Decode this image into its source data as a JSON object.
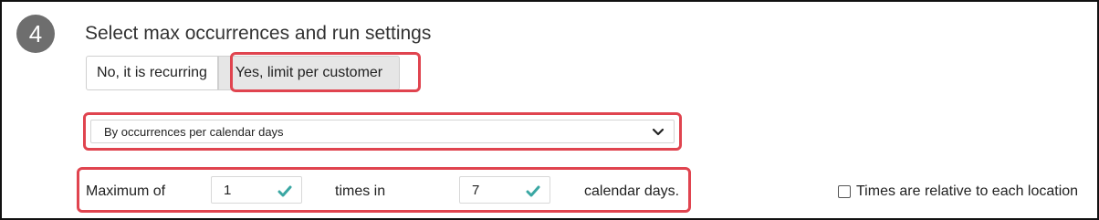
{
  "step": {
    "number": "4",
    "title": "Select max occurrences and run settings"
  },
  "recurrence_toggle": {
    "options": [
      "No, it is recurring",
      "Yes, limit per customer"
    ],
    "selected_index": 1
  },
  "limit_type": {
    "selected": "By occurrences per calendar days"
  },
  "limit_row": {
    "prefix": "Maximum of",
    "times_value": "1",
    "middle": "times in",
    "days_value": "7",
    "suffix": "calendar days."
  },
  "relative_checkbox": {
    "label": "Times are relative to each location",
    "checked": false
  },
  "colors": {
    "highlight": "#e0444f",
    "valid_check": "#3aa7a3",
    "selected_button": "#e6e6e6"
  }
}
